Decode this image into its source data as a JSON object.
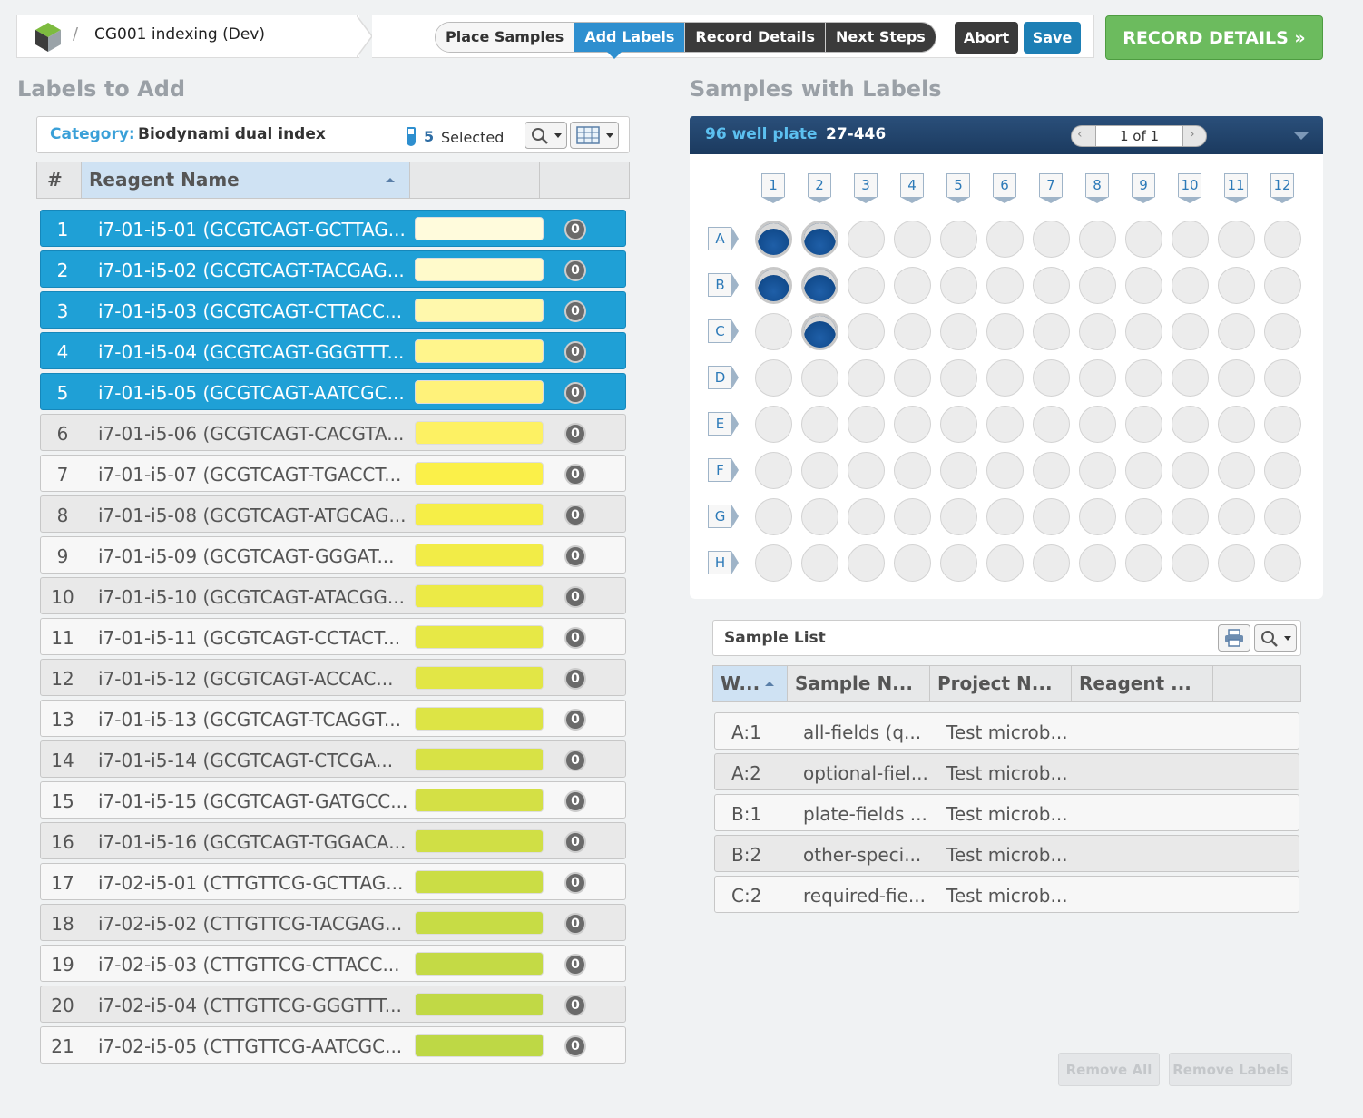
{
  "breadcrumb": {
    "separator": "/",
    "project": "CG001 indexing (Dev)"
  },
  "steps": [
    {
      "label": "Place Samples",
      "state": "done"
    },
    {
      "label": "Add Labels",
      "state": "active"
    },
    {
      "label": "Record Details",
      "state": "pending"
    },
    {
      "label": "Next Steps",
      "state": "pending"
    }
  ],
  "actions": {
    "abort": "Abort",
    "save": "Save",
    "next": "RECORD DETAILS »"
  },
  "labels_panel": {
    "title": "Labels to Add",
    "category_label": "Category:",
    "category_value": "Biodynami dual index",
    "selected_count": "5",
    "selected_text": "Selected",
    "columns": [
      "#",
      "Reagent Name"
    ],
    "rows": [
      {
        "num": "1",
        "name": "i7-01-i5-01 (GCGTCAGT-GCTTAG...",
        "count": "0",
        "selected": true,
        "color": "#fffbdc"
      },
      {
        "num": "2",
        "name": "i7-01-i5-02 (GCGTCAGT-TACGAG...",
        "count": "0",
        "selected": true,
        "color": "#fffacb"
      },
      {
        "num": "3",
        "name": "i7-01-i5-03 (GCGTCAGT-CTTACC...",
        "count": "0",
        "selected": true,
        "color": "#fff8ac"
      },
      {
        "num": "4",
        "name": "i7-01-i5-04 (GCGTCAGT-GGGTTT...",
        "count": "0",
        "selected": true,
        "color": "#fff58c"
      },
      {
        "num": "5",
        "name": "i7-01-i5-05 (GCGTCAGT-AATCGC...",
        "count": "0",
        "selected": true,
        "color": "#fff27a"
      },
      {
        "num": "6",
        "name": "i7-01-i5-06 (GCGTCAGT-CACGTA...",
        "count": "0",
        "selected": false,
        "color": "#fdf163"
      },
      {
        "num": "7",
        "name": "i7-01-i5-07 (GCGTCAGT-TGACCT...",
        "count": "0",
        "selected": false,
        "color": "#fbf049"
      },
      {
        "num": "8",
        "name": "i7-01-i5-08 (GCGTCAGT-ATGCAG...",
        "count": "0",
        "selected": false,
        "color": "#f6ee47"
      },
      {
        "num": "9",
        "name": "i7-01-i5-09 (GCGTCAGT-GGGAT...",
        "count": "0",
        "selected": false,
        "color": "#f2ec47"
      },
      {
        "num": "10",
        "name": "i7-01-i5-10 (GCGTCAGT-ATACGG...",
        "count": "0",
        "selected": false,
        "color": "#ecea46"
      },
      {
        "num": "11",
        "name": "i7-01-i5-11 (GCGTCAGT-CCTACT...",
        "count": "0",
        "selected": false,
        "color": "#e7e846"
      },
      {
        "num": "12",
        "name": "i7-01-i5-12 (GCGTCAGT-ACCAC...",
        "count": "0",
        "selected": false,
        "color": "#e2e646"
      },
      {
        "num": "13",
        "name": "i7-01-i5-13 (GCGTCAGT-TCAGGT...",
        "count": "0",
        "selected": false,
        "color": "#dde445"
      },
      {
        "num": "14",
        "name": "i7-01-i5-14 (GCGTCAGT-CTCGA...",
        "count": "0",
        "selected": false,
        "color": "#d8e245"
      },
      {
        "num": "15",
        "name": "i7-01-i5-15 (GCGTCAGT-GATGCC...",
        "count": "0",
        "selected": false,
        "color": "#d4e045"
      },
      {
        "num": "16",
        "name": "i7-01-i5-16 (GCGTCAGT-TGGACA...",
        "count": "0",
        "selected": false,
        "color": "#d0df45"
      },
      {
        "num": "17",
        "name": "i7-02-i5-01 (CTTGTTCG-GCTTAG...",
        "count": "0",
        "selected": false,
        "color": "#cbdd45"
      },
      {
        "num": "18",
        "name": "i7-02-i5-02 (CTTGTTCG-TACGAG...",
        "count": "0",
        "selected": false,
        "color": "#c7dc45"
      },
      {
        "num": "19",
        "name": "i7-02-i5-03 (CTTGTTCG-CTTACC...",
        "count": "0",
        "selected": false,
        "color": "#c4da45"
      },
      {
        "num": "20",
        "name": "i7-02-i5-04 (CTTGTTCG-GGGTTT...",
        "count": "0",
        "selected": false,
        "color": "#c1d945"
      },
      {
        "num": "21",
        "name": "i7-02-i5-05 (CTTGTTCG-AATCGC...",
        "count": "0",
        "selected": false,
        "color": "#bed845"
      }
    ]
  },
  "samples_panel": {
    "title": "Samples with Labels",
    "plate_type": "96 well plate",
    "plate_id": "27-446",
    "pager_text": "1 of 1",
    "prev_glyph": "‹",
    "next_glyph": "›",
    "columns": [
      "1",
      "2",
      "3",
      "4",
      "5",
      "6",
      "7",
      "8",
      "9",
      "10",
      "11",
      "12"
    ],
    "rows": [
      "A",
      "B",
      "C",
      "D",
      "E",
      "F",
      "G",
      "H"
    ],
    "filled_wells": [
      "A1",
      "A2",
      "B1",
      "B2",
      "C2"
    ]
  },
  "sample_list": {
    "title": "Sample List",
    "columns": [
      "W...",
      "Sample N...",
      "Project N...",
      "Reagent ..."
    ],
    "rows": [
      {
        "well": "A:1",
        "sample": "all-fields (q...",
        "project": "Test microb..."
      },
      {
        "well": "A:2",
        "sample": "optional-fiel...",
        "project": "Test microb..."
      },
      {
        "well": "B:1",
        "sample": "plate-fields ...",
        "project": "Test microb..."
      },
      {
        "well": "B:2",
        "sample": "other-speci...",
        "project": "Test microb..."
      },
      {
        "well": "C:2",
        "sample": "required-fie...",
        "project": "Test microb..."
      }
    ],
    "remove_all": "Remove All",
    "remove_labels": "Remove Labels"
  }
}
